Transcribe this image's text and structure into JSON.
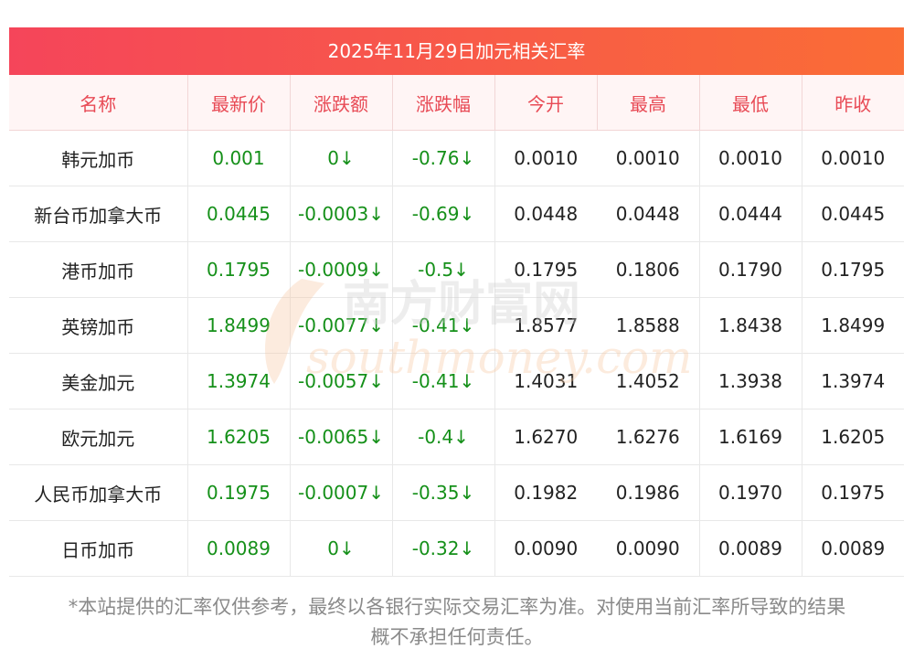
{
  "title": "2025年11月29日加元相关汇率",
  "headers": [
    "名称",
    "最新价",
    "涨跌额",
    "涨跌幅",
    "今开",
    "最高",
    "最低",
    "昨收"
  ],
  "rows": [
    {
      "name": "韩元加币",
      "last": "0.001",
      "change": "0↓",
      "pct": "-0.76↓",
      "open": "0.0010",
      "high": "0.0010",
      "low": "0.0010",
      "prev": "0.0010"
    },
    {
      "name": "新台币加拿大币",
      "last": "0.0445",
      "change": "-0.0003↓",
      "pct": "-0.69↓",
      "open": "0.0448",
      "high": "0.0448",
      "low": "0.0444",
      "prev": "0.0445"
    },
    {
      "name": "港币加币",
      "last": "0.1795",
      "change": "-0.0009↓",
      "pct": "-0.5↓",
      "open": "0.1795",
      "high": "0.1806",
      "low": "0.1790",
      "prev": "0.1795"
    },
    {
      "name": "英镑加币",
      "last": "1.8499",
      "change": "-0.0077↓",
      "pct": "-0.41↓",
      "open": "1.8577",
      "high": "1.8588",
      "low": "1.8438",
      "prev": "1.8499"
    },
    {
      "name": "美金加元",
      "last": "1.3974",
      "change": "-0.0057↓",
      "pct": "-0.41↓",
      "open": "1.4031",
      "high": "1.4052",
      "low": "1.3938",
      "prev": "1.3974"
    },
    {
      "name": "欧元加元",
      "last": "1.6205",
      "change": "-0.0065↓",
      "pct": "-0.4↓",
      "open": "1.6270",
      "high": "1.6276",
      "low": "1.6169",
      "prev": "1.6205"
    },
    {
      "name": "人民币加拿大币",
      "last": "0.1975",
      "change": "-0.0007↓",
      "pct": "-0.35↓",
      "open": "0.1982",
      "high": "0.1986",
      "low": "0.1970",
      "prev": "0.1975"
    },
    {
      "name": "日币加币",
      "last": "0.0089",
      "change": "0↓",
      "pct": "-0.32↓",
      "open": "0.0090",
      "high": "0.0090",
      "low": "0.0089",
      "prev": "0.0089"
    }
  ],
  "note_line1": "*本站提供的汇率仅供参考，最终以各银行实际交易汇率为准。对使用当前汇率所导致的结果",
  "note_line2": "概不承担任何责任。",
  "watermark_cn": "南方财富网",
  "watermark_en": "southmoney.com",
  "colors": {
    "header_red": "#e84a55",
    "positive_green": "#159019",
    "title_grad_start": "#f5455a",
    "title_grad_end": "#fa6d35"
  }
}
